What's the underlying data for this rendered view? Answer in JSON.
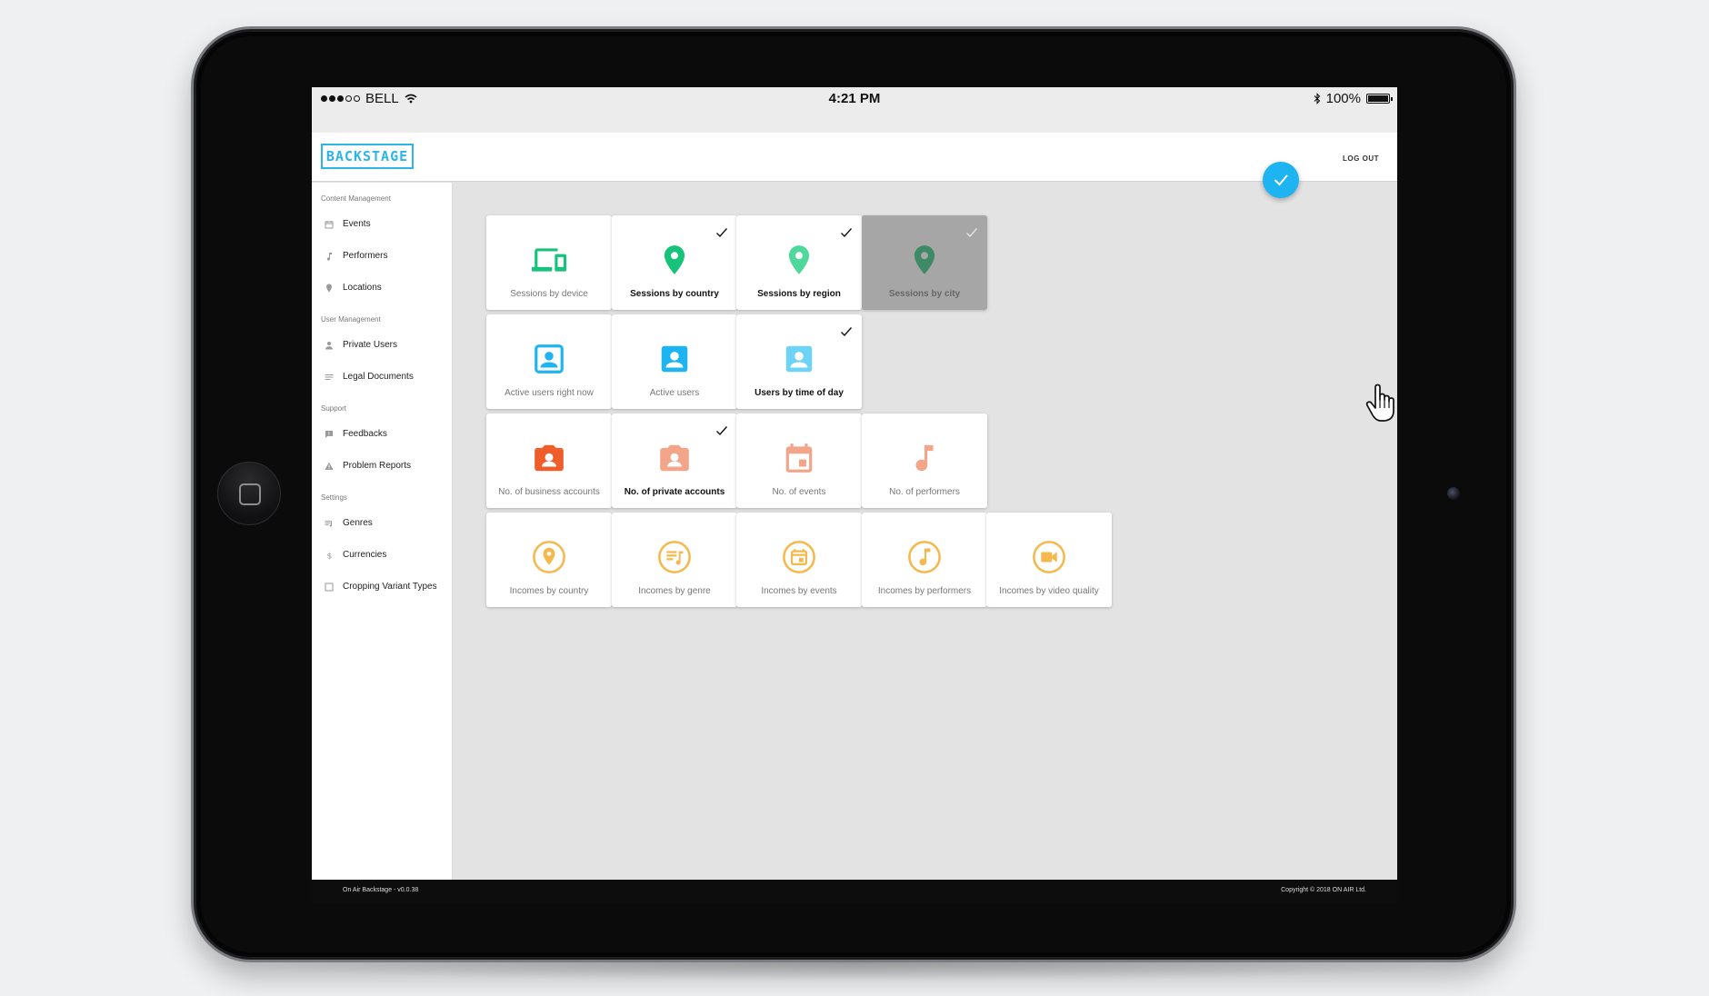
{
  "status": {
    "carrier": "BELL",
    "time": "4:21 PM",
    "battery": "100%"
  },
  "header": {
    "logo": "BACKSTAGE",
    "logout": "LOG OUT"
  },
  "sidebar": {
    "sections": [
      {
        "title": "Content Management",
        "items": [
          {
            "label": "Events",
            "icon": "calendar-icon"
          },
          {
            "label": "Performers",
            "icon": "music-note-icon"
          },
          {
            "label": "Locations",
            "icon": "location-pin-icon"
          }
        ]
      },
      {
        "title": "User Management",
        "items": [
          {
            "label": "Private Users",
            "icon": "person-icon"
          },
          {
            "label": "Legal Documents",
            "icon": "lines-icon"
          }
        ]
      },
      {
        "title": "Support",
        "items": [
          {
            "label": "Feedbacks",
            "icon": "feedback-icon"
          },
          {
            "label": "Problem Reports",
            "icon": "warning-icon"
          }
        ]
      },
      {
        "title": "Settings",
        "items": [
          {
            "label": "Genres",
            "icon": "playlist-icon"
          },
          {
            "label": "Currencies",
            "icon": "dollar-icon"
          },
          {
            "label": "Cropping Variant Types",
            "icon": "square-icon"
          }
        ]
      }
    ]
  },
  "tiles": [
    [
      {
        "label": "Sessions by device",
        "icon": "devices-icon",
        "color": "#17c37b",
        "selected": false
      },
      {
        "label": "Sessions by country",
        "icon": "location-pin-icon",
        "color": "#17c37b",
        "selected": true
      },
      {
        "label": "Sessions by region",
        "icon": "location-pin-icon",
        "color": "#4fd89b",
        "selected": true
      },
      {
        "label": "Sessions by city",
        "icon": "location-pin-icon",
        "color": "#3f8a66",
        "selected": true,
        "pressed": true
      }
    ],
    [
      {
        "label": "Active users right now",
        "icon": "account-box-outline-icon",
        "color": "#1eb4f2",
        "selected": false
      },
      {
        "label": "Active users",
        "icon": "account-box-icon",
        "color": "#1eb4f2",
        "selected": false
      },
      {
        "label": "Users by time of day",
        "icon": "account-box-icon",
        "color": "#6dd3f7",
        "selected": true
      }
    ],
    [
      {
        "label": "No. of business accounts",
        "icon": "camera-person-icon",
        "color": "#ef5d2a",
        "selected": false
      },
      {
        "label": "No. of private accounts",
        "icon": "camera-person-icon",
        "color": "#f3a58a",
        "selected": true
      },
      {
        "label": "No. of events",
        "icon": "calendar-icon",
        "color": "#f3a58a",
        "selected": false
      },
      {
        "label": "No. of performers",
        "icon": "music-note-icon",
        "color": "#f3a58a",
        "selected": false
      }
    ],
    [
      {
        "label": "Incomes by country",
        "icon": "circle-pin-icon",
        "color": "#f5b84c",
        "selected": false
      },
      {
        "label": "Incomes by genre",
        "icon": "circle-playlist-icon",
        "color": "#f5b84c",
        "selected": false
      },
      {
        "label": "Incomes by events",
        "icon": "circle-calendar-icon",
        "color": "#f5b84c",
        "selected": false
      },
      {
        "label": "Incomes by performers",
        "icon": "circle-note-icon",
        "color": "#f5b84c",
        "selected": false
      },
      {
        "label": "Incomes by video quality",
        "icon": "circle-video-icon",
        "color": "#f5b84c",
        "selected": false
      }
    ]
  ],
  "footer": {
    "version": "On Air Backstage - v0.0.38",
    "copyright": "Copyright © 2018 ON AIR Ltd."
  },
  "colors": {
    "accent": "#1eb4f2",
    "logo": "#2cb5e6"
  }
}
